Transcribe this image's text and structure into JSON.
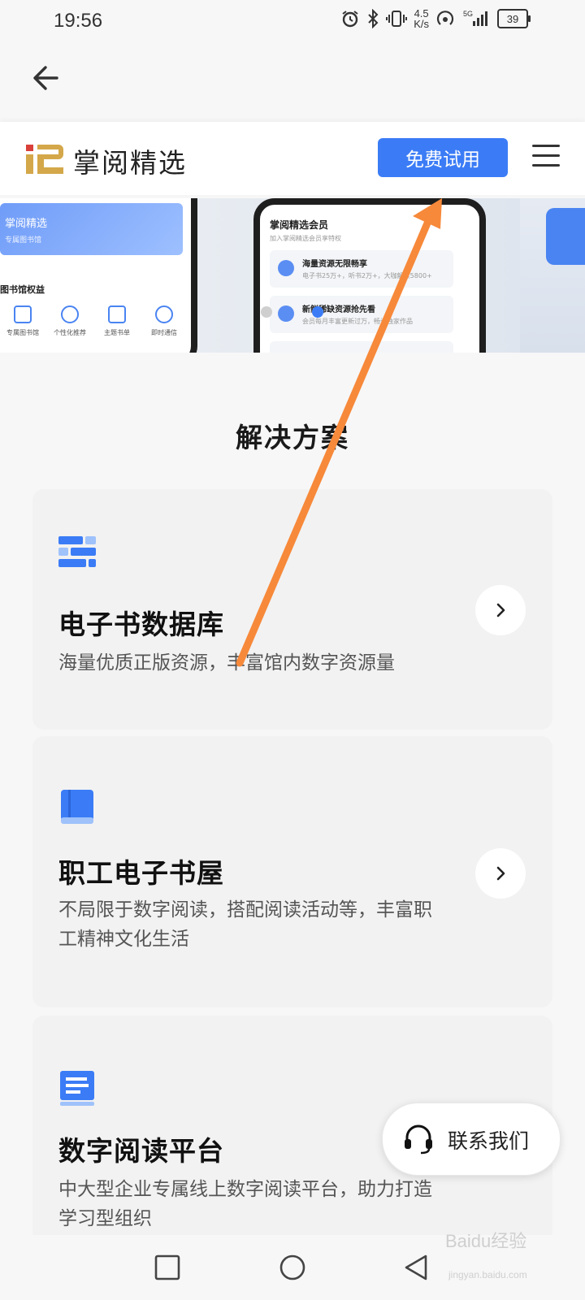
{
  "status_bar": {
    "time": "19:56",
    "net_speed_value": "4.5",
    "net_speed_unit": "K/s",
    "battery": "39"
  },
  "header": {
    "brand": "掌阅精选",
    "trial_button": "免费试用"
  },
  "banner": {
    "left_phone": {
      "title": "掌阅精选",
      "subtitle": "专属图书馆",
      "section": "图书馆权益",
      "icons": [
        "专属图书馆",
        "个性化推荐",
        "主题书单",
        "即时通信"
      ]
    },
    "mid_phone": {
      "title": "掌阅精选会员",
      "subtitle": "加入掌阅精选会员享特权",
      "items": [
        {
          "title": "海量资源无限畅享",
          "desc": "电子书25万+，听书2万+，大咖解读5800+"
        },
        {
          "title": "新鲜稀缺资源抢先看",
          "desc": "会员每月丰富更新过万，畅读独家作品"
        }
      ]
    }
  },
  "section_title": "解决方案",
  "cards": [
    {
      "title": "电子书数据库",
      "desc": "海量优质正版资源，丰富馆内数字资源量"
    },
    {
      "title": "职工电子书屋",
      "desc": "不局限于数字阅读，搭配阅读活动等，丰富职工精神文化生活"
    },
    {
      "title": "数字阅读平台",
      "desc": "中大型企业专属线上数字阅读平台，助力打造学习型组织"
    }
  ],
  "contact_button": "联系我们",
  "watermark": {
    "text": "Baidu经验",
    "sub": "jingyan.baidu.com"
  },
  "colors": {
    "accent": "#3b7cf6",
    "annotation_arrow": "#f7893a",
    "logo_red": "#d9403a",
    "logo_gold": "#d4a84a"
  },
  "icons": [
    "back-arrow-icon",
    "hamburger-menu-icon",
    "database-icon",
    "book-icon",
    "document-icon",
    "chevron-right-icon",
    "headset-icon"
  ]
}
